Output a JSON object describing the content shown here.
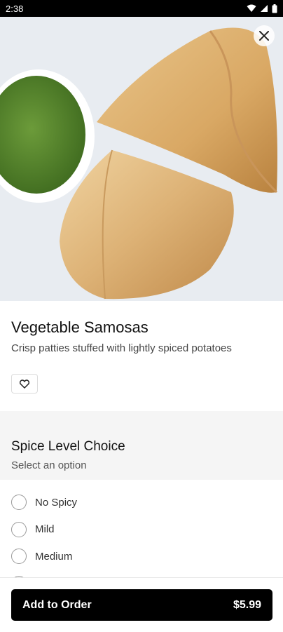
{
  "status_bar": {
    "time": "2:38",
    "icons": [
      "wifi-icon",
      "signal-icon",
      "battery-icon"
    ]
  },
  "item": {
    "image_alt": "samosas with green chutney",
    "title": "Vegetable Samosas",
    "description": "Crisp patties stuffed with lightly spiced potatoes"
  },
  "icons": {
    "close": "close-icon",
    "favorite": "heart-icon"
  },
  "modifier_group": {
    "title": "Spice Level Choice",
    "subtitle": "Select an option",
    "options": [
      {
        "label": "No Spicy",
        "selected": false
      },
      {
        "label": "Mild",
        "selected": false
      },
      {
        "label": "Medium",
        "selected": false
      }
    ]
  },
  "footer": {
    "add_label": "Add to Order",
    "price": "$5.99"
  },
  "colors": {
    "primary_button": "#000000",
    "chutney": "#5a8a2e",
    "section_bg": "#f5f5f5"
  }
}
